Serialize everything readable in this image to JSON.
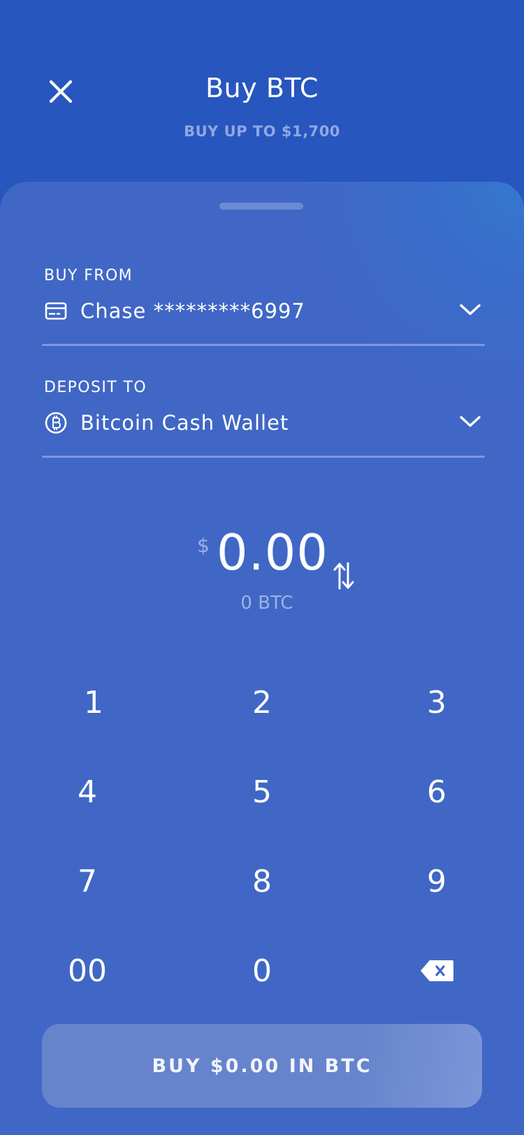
{
  "header": {
    "title": "Buy BTC",
    "subtitle": "BUY UP TO $1,700",
    "close_icon": "close-icon"
  },
  "buy_from": {
    "label": "BUY FROM",
    "value": "Chase *********6997",
    "icon": "credit-card-icon"
  },
  "deposit_to": {
    "label": "DEPOSIT TO",
    "value": "Bitcoin Cash Wallet",
    "icon": "bitcoin-icon"
  },
  "amount": {
    "currency_symbol": "$",
    "value": "0.00",
    "converted": "0 BTC"
  },
  "keypad": {
    "keys": [
      "1",
      "2",
      "3",
      "4",
      "5",
      "6",
      "7",
      "8",
      "9",
      "00",
      "0"
    ],
    "backspace_icon": "backspace-icon"
  },
  "buy_button": {
    "label": "BUY $0.00 IN BTC"
  },
  "colors": {
    "header_bg": "#2756be",
    "sheet_bg": "#4067c5",
    "muted_text": "#9cb2e6",
    "button_bg": "#6683cc"
  }
}
